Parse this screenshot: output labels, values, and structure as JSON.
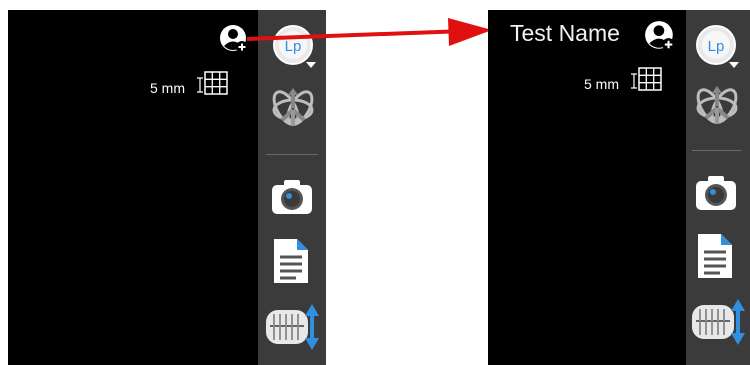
{
  "before": {
    "scale": {
      "value": "5 mm"
    }
  },
  "after": {
    "patient_name": "Test Name",
    "scale": {
      "value": "5 mm"
    }
  },
  "toolbar": {
    "logo_text": "Lp",
    "icons": [
      "profile-menu-icon",
      "3d-orientation-icon",
      "camera-icon",
      "document-icon",
      "teeth-occlusion-icon"
    ]
  },
  "colors": {
    "viewport": "#000000",
    "toolbar": "#3b3b3b",
    "arrow": "#e01010",
    "accent_blue": "#2f8fe0"
  }
}
